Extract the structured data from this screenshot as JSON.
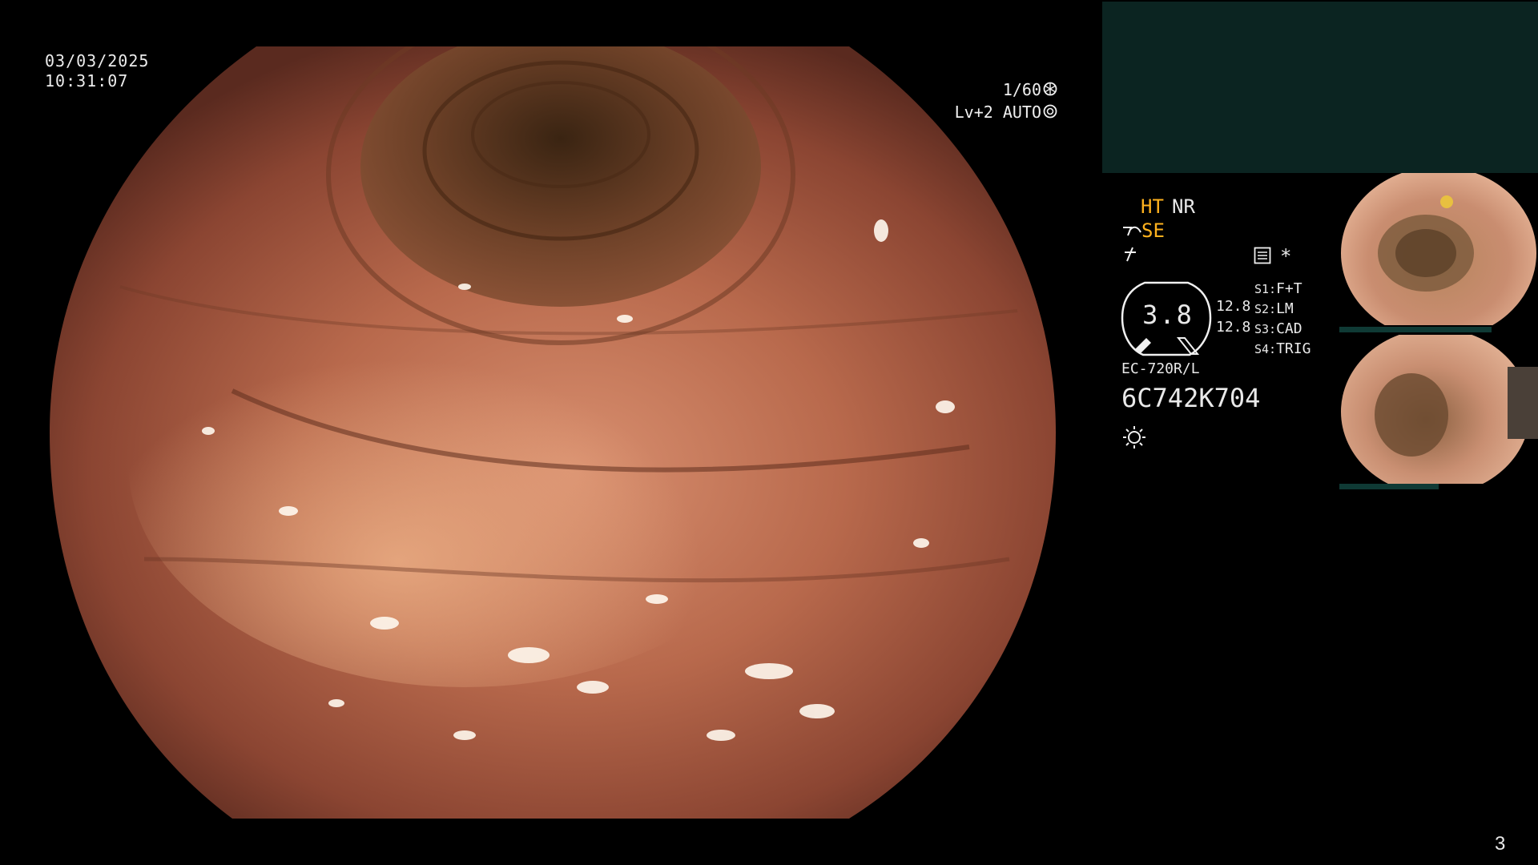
{
  "overlay": {
    "date": "03/03/2025",
    "time": "10:31:07",
    "shutter": "1/60",
    "shutter_icon": "aperture-icon",
    "level": "Lv+2 AUTO",
    "level_icon": "iris-icon"
  },
  "status": {
    "ht": "HT",
    "nr": "NR",
    "se": "SE",
    "se_icon": "scope-icon",
    "mode_icon": "slash-icon",
    "record_icon": "record-icon",
    "asterisk": "*",
    "dial_value": "3.8",
    "values": [
      "12.8",
      "12.8"
    ],
    "switches": [
      {
        "key": "S1:",
        "val": "F+T"
      },
      {
        "key": "S2:",
        "val": "LM"
      },
      {
        "key": "S3:",
        "val": "CAD"
      },
      {
        "key": "S4:",
        "val": "TRIG"
      }
    ],
    "model": "EC-720R/L",
    "serial": "6C742K704",
    "light_icon": "sun-icon"
  },
  "page_number": "3",
  "colors": {
    "accent_yellow": "#ffb21e",
    "panel_green": "#0b2421",
    "tissue": "#b0654a"
  }
}
